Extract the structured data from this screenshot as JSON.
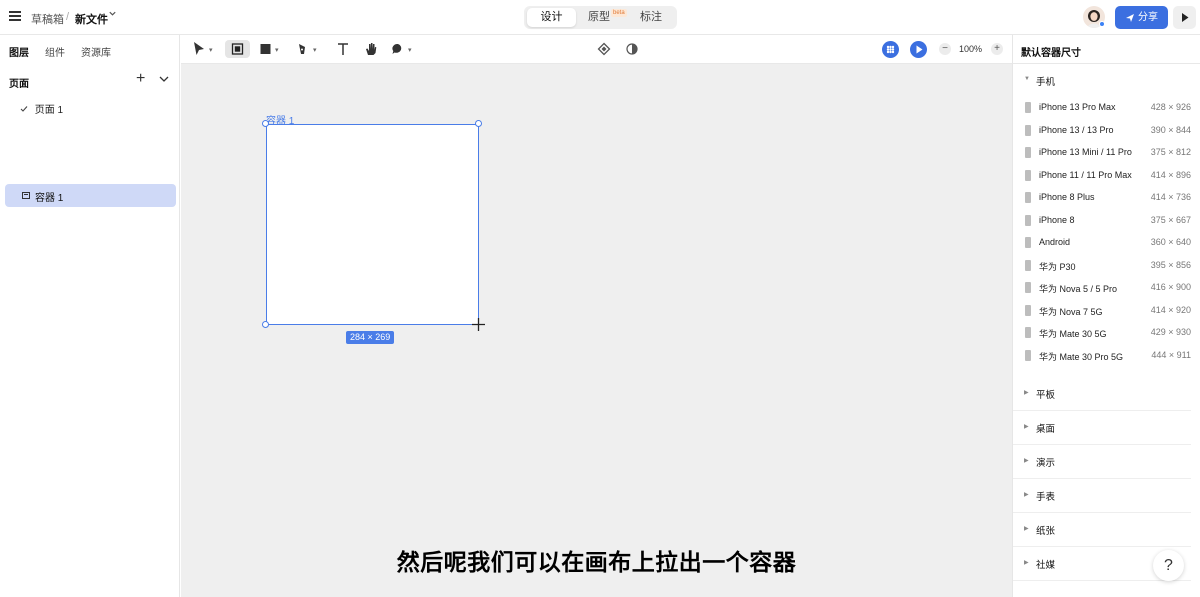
{
  "topbar": {
    "breadcrumb_drafts": "草稿箱",
    "breadcrumb_sep": "/",
    "file_name": "新文件",
    "modes": {
      "design": "设计",
      "prototype": "原型",
      "beta": "beta",
      "annotate": "标注"
    },
    "share_label": "分享"
  },
  "left_panel": {
    "tabs": {
      "layers": "图层",
      "components": "组件",
      "assets": "资源库"
    },
    "pages_title": "页面",
    "add_symbol": "+",
    "pages": [
      {
        "label": "页面 1",
        "selected": true
      }
    ],
    "layers": [
      {
        "label": "容器 1",
        "selected": true
      }
    ]
  },
  "toolbar": {
    "zoom_level": "100%",
    "zoom_minus": "−",
    "zoom_plus": "+"
  },
  "canvas": {
    "frame_label": "容器 1",
    "size_badge": "284 × 269",
    "subtitle": "然后呢我们可以在画布上拉出一个容器"
  },
  "right_panel": {
    "title": "默认容器尺寸",
    "expanded_section": "手机",
    "devices": [
      {
        "name": "iPhone 13 Pro Max",
        "size": "428 × 926"
      },
      {
        "name": "iPhone 13 / 13 Pro",
        "size": "390 × 844"
      },
      {
        "name": "iPhone 13 Mini / 11 Pro",
        "size": "375 × 812"
      },
      {
        "name": "iPhone 11 / 11 Pro Max",
        "size": "414 × 896"
      },
      {
        "name": "iPhone 8 Plus",
        "size": "414 × 736"
      },
      {
        "name": "iPhone 8",
        "size": "375 × 667"
      },
      {
        "name": "Android",
        "size": "360 × 640"
      },
      {
        "name": "华为 P30",
        "size": "395 × 856"
      },
      {
        "name": "华为 Nova 5 / 5 Pro",
        "size": "416 × 900"
      },
      {
        "name": "华为 Nova 7 5G",
        "size": "414 × 920"
      },
      {
        "name": "华为 Mate 30 5G",
        "size": "429 × 930"
      },
      {
        "name": "华为 Mate 30 Pro 5G",
        "size": "444 × 911"
      }
    ],
    "collapsed_sections": [
      "平板",
      "桌面",
      "演示",
      "手表",
      "纸张",
      "社媒"
    ]
  },
  "help_label": "?",
  "colors": {
    "accent": "#3b6fe0",
    "selection": "#4a7de8",
    "canvas_bg": "#efefef",
    "layer_highlight": "#cfd9f7"
  },
  "icons": [
    "menu-icon",
    "chevron-down-icon",
    "share-icon",
    "play-icon",
    "plus-icon",
    "check-icon",
    "frame-icon",
    "pointer-icon",
    "rectangle-icon",
    "pen-icon",
    "text-icon",
    "hand-icon",
    "comment-icon",
    "component-icon",
    "contrast-icon",
    "grid-icon",
    "present-icon",
    "device-icon",
    "help-icon",
    "crosshair-icon"
  ]
}
